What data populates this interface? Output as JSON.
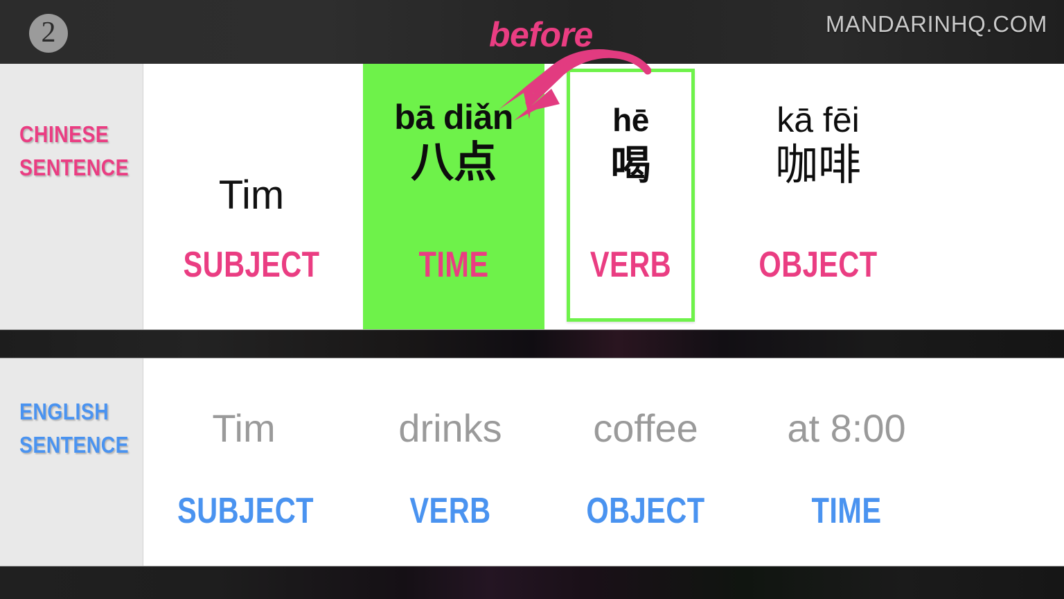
{
  "header": {
    "step_number": "2",
    "site": "MANDARINHQ.COM"
  },
  "annotation": {
    "label": "before",
    "color": "#ea3d82",
    "arrow": "curved-arrow-pointing-down-left"
  },
  "colors": {
    "highlight_green": "#6ef24a",
    "chinese_pink": "#ea3d82",
    "english_blue": "#4a93f0",
    "label_column_gray": "#e9e9e9",
    "english_text_gray": "#9a9a9a"
  },
  "chinese_row": {
    "label_line1": "CHINESE",
    "label_line2": "SENTENCE",
    "cells": [
      {
        "pinyin": "Tim",
        "hanzi": "",
        "role": "SUBJECT",
        "highlight": "none"
      },
      {
        "pinyin": "bā diǎn",
        "hanzi": "八点",
        "role": "TIME",
        "highlight": "green-fill"
      },
      {
        "pinyin": "hē",
        "hanzi": "喝",
        "role": "VERB",
        "highlight": "green-outline"
      },
      {
        "pinyin": "kā fēi",
        "hanzi": "咖啡",
        "role": "OBJECT",
        "highlight": "none"
      }
    ]
  },
  "english_row": {
    "label_line1": "ENGLISH",
    "label_line2": "SENTENCE",
    "cells": [
      {
        "word": "Tim",
        "role": "SUBJECT"
      },
      {
        "word": "drinks",
        "role": "VERB"
      },
      {
        "word": "coffee",
        "role": "OBJECT"
      },
      {
        "word": "at 8:00",
        "role": "TIME"
      }
    ]
  }
}
